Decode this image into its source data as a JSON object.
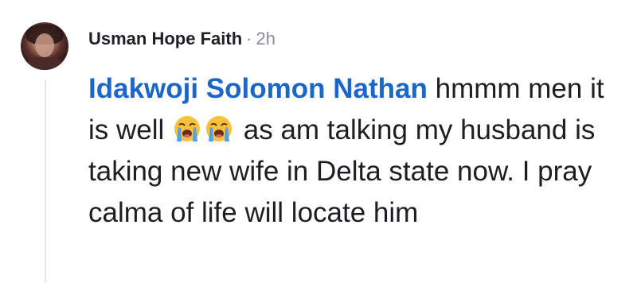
{
  "comment": {
    "author": "Usman Hope Faith",
    "separator": "·",
    "time": "2h",
    "mention": "Idakwoji Solomon Nathan",
    "text_part1": "hmmm men it is well",
    "emojis": [
      "loudly-crying-face-icon",
      "loudly-crying-face-icon"
    ],
    "text_part2": "as am talking my husband is taking new wife in Delta state now. I pray calma of life will locate him"
  },
  "colors": {
    "mention": "#1a66c9",
    "text": "#1c1e21",
    "meta": "#8a8d91"
  }
}
